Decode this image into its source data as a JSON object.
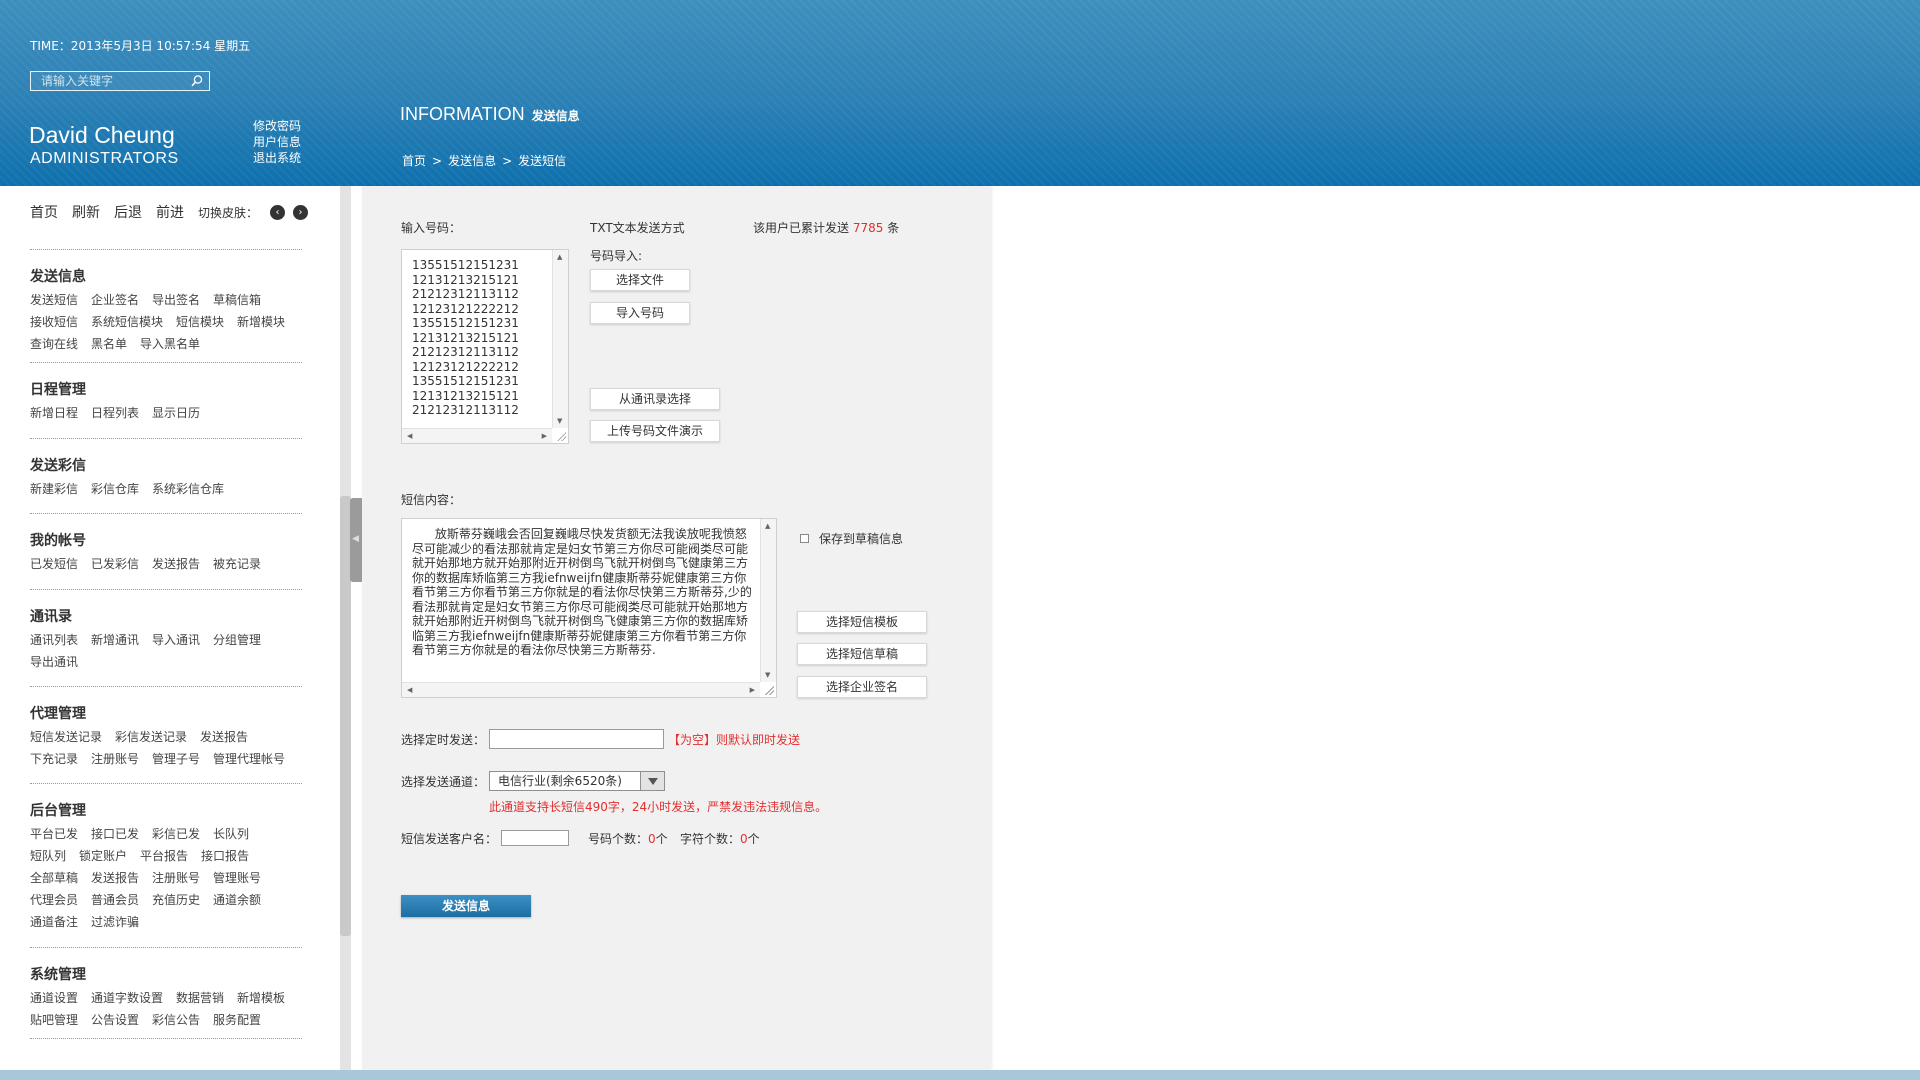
{
  "header": {
    "time_text": "TIME：2013年5月3日 10:57:54 星期五",
    "search_placeholder": "请输入关键字",
    "user_name": "David Cheung",
    "user_role": "ADMINISTRATORS",
    "user_links": [
      "修改密码",
      "用户信息",
      "退出系统"
    ],
    "page_title": "INFORMATION",
    "page_subtitle": "发送信息",
    "breadcrumb": [
      "首页",
      "发送信息",
      "发送短信"
    ],
    "breadcrumb_sep": ">"
  },
  "topnav": {
    "items": [
      "首页",
      "刷新",
      "后退",
      "前进"
    ],
    "skin_label": "切换皮肤：",
    "prev_icon": "‹",
    "next_icon": "›"
  },
  "sidebar": [
    {
      "title": "发送信息",
      "items": [
        "发送短信",
        "企业签名",
        "导出签名",
        "草稿信箱",
        "接收短信",
        "系统短信模块",
        "短信模块",
        "新增模块",
        "查询在线",
        "黑名单",
        "导入黑名单"
      ]
    },
    {
      "title": "日程管理",
      "items": [
        "新增日程",
        "日程列表",
        "显示日历"
      ]
    },
    {
      "title": "发送彩信",
      "items": [
        "新建彩信",
        "彩信仓库",
        "系统彩信仓库"
      ]
    },
    {
      "title": "我的帐号",
      "items": [
        "已发短信",
        "已发彩信",
        "发送报告",
        "被充记录"
      ]
    },
    {
      "title": "通讯录",
      "items": [
        "通讯列表",
        "新增通讯",
        "导入通讯",
        "分组管理",
        "导出通讯"
      ]
    },
    {
      "title": "代理管理",
      "items": [
        "短信发送记录",
        "彩信发送记录",
        "发送报告",
        "下充记录",
        "注册账号",
        "管理子号",
        "管理代理帐号"
      ]
    },
    {
      "title": "后台管理",
      "items": [
        "平台已发",
        "接口已发",
        "彩信已发",
        "长队列",
        "短队列",
        "锁定账户",
        "平台报告",
        "接口报告",
        "全部草稿",
        "发送报告",
        "注册账号",
        "管理账号",
        "代理会员",
        "普通会员",
        "充值历史",
        "通道余额",
        "通道备注",
        "过滤诈骗"
      ]
    },
    {
      "title": "系统管理",
      "items": [
        "通道设置",
        "通道字数设置",
        "数据营销",
        "新增模板",
        "贴吧管理",
        "公告设置",
        "彩信公告",
        "服务配置"
      ]
    }
  ],
  "form": {
    "numbers_label": "输入号码：",
    "numbers": [
      "13551512151231",
      "12131213215121",
      "21212312113112",
      "12123121222212",
      "13551512151231",
      "12131213215121",
      "21212312113112",
      "12123121222212",
      "13551512151231",
      "12131213215121",
      "21212312113112"
    ],
    "txt_mode_label": "TXT文本发送方式",
    "import_label": "号码导入:",
    "choose_file": "选择文件",
    "import_numbers": "导入号码",
    "from_contacts": "从通讯录选择",
    "upload_demo": "上传号码文件演示",
    "sent_prefix": "该用户已累计发送",
    "sent_count": "7785",
    "sent_suffix": "条",
    "content_label": "短信内容：",
    "content_text": "      放斯蒂芬巍峨会否回复巍峨尽快发货额无法我诶放呢我愤怒尽可能减少的看法那就肯定是妇女节第三方你尽可能阀类尽可能就开始那地方就开始那附近开树倒鸟飞就开树倒鸟飞健康第三方你的数据库矫临第三方我iefnweijfn健康斯蒂芬妮健康第三方你看节第三方你看节第三方你就是的看法你尽快第三方斯蒂芬,少的看法那就肯定是妇女节第三方你尽可能阀类尽可能就开始那地方就开始那附近开树倒鸟飞就开树倒鸟飞健康第三方你的数据库矫临第三方我iefnweijfn健康斯蒂芬妮健康第三方你看节第三方你看节第三方你就是的看法你尽快第三方斯蒂芬.",
    "save_draft": "保存到草稿信息",
    "select_template": "选择短信模板",
    "select_draft": "选择短信草稿",
    "select_signature": "选择企业签名",
    "schedule_label": "选择定时发送：",
    "schedule_value": "",
    "schedule_note": "【为空】则默认即时发送",
    "channel_label": "选择发送通道：",
    "channel_value": "电信行业(剩余6520条)",
    "channel_note": "此通道支持长短信490字，24小时发送，严禁发违法违规信息。",
    "customer_label": "短信发送客户名：",
    "customer_value": "",
    "num_count_label": "号码个数：",
    "num_count": "0",
    "num_count_unit": "个",
    "char_count_label": "字符个数：",
    "char_count": "0",
    "char_count_unit": "个",
    "send_button": "发送信息"
  },
  "colors": {
    "header": "#2b80b5",
    "accent_red": "#e23030",
    "send_button": "#2a7db3",
    "panel": "#f1f1f1"
  }
}
